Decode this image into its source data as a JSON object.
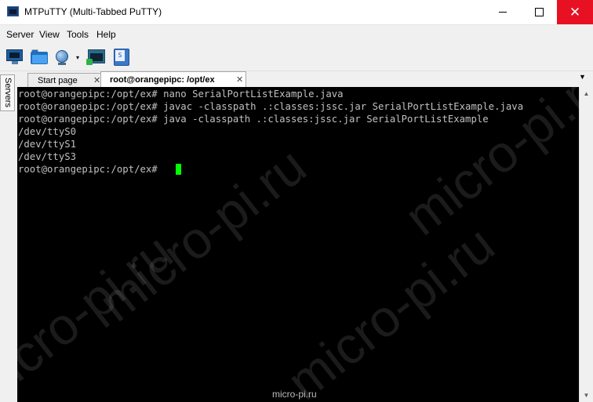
{
  "window": {
    "title": "MTPuTTY (Multi-Tabbed PuTTY)",
    "minimize_icon": "minimize-icon",
    "maximize_icon": "maximize-icon",
    "close_icon": "close-icon",
    "close_color": "#e81123"
  },
  "menu": {
    "items": [
      "Server",
      "View",
      "Tools",
      "Help"
    ]
  },
  "toolbar": {
    "buttons": [
      {
        "icon": "monitor-icon",
        "name": "new-server-button"
      },
      {
        "icon": "folder-icon",
        "name": "open-button"
      },
      {
        "icon": "globe-icon",
        "name": "connect-button"
      },
      {
        "icon": "terminal-icon",
        "name": "run-putty-button"
      },
      {
        "icon": "script-icon",
        "name": "send-script-button"
      }
    ],
    "dropdown_arrow": "▾",
    "script_glyph": "S"
  },
  "side": {
    "servers_label": "Servers"
  },
  "tabs": [
    {
      "label": "Start page",
      "active": false,
      "close": "✕"
    },
    {
      "label": "root@orangepipc: /opt/ex",
      "active": true,
      "close": "✕"
    }
  ],
  "tab_menu_arrow": "▼",
  "terminal": {
    "lines": [
      "root@orangepipc:/opt/ex# nano SerialPortListExample.java",
      "root@orangepipc:/opt/ex# javac -classpath .:classes:jssc.jar SerialPortListExample.java",
      "root@orangepipc:/opt/ex# java -classpath .:classes:jssc.jar SerialPortListExample",
      "/dev/ttyS0",
      "/dev/ttyS1",
      "/dev/ttyS3",
      "root@orangepipc:/opt/ex# "
    ],
    "background": "#000000",
    "text_color": "#c0c0c0",
    "cursor_color": "#00ff00"
  },
  "watermark": {
    "text": "micro-pi.ru"
  },
  "scrollbar": {
    "up": "▲",
    "down": "▼"
  }
}
